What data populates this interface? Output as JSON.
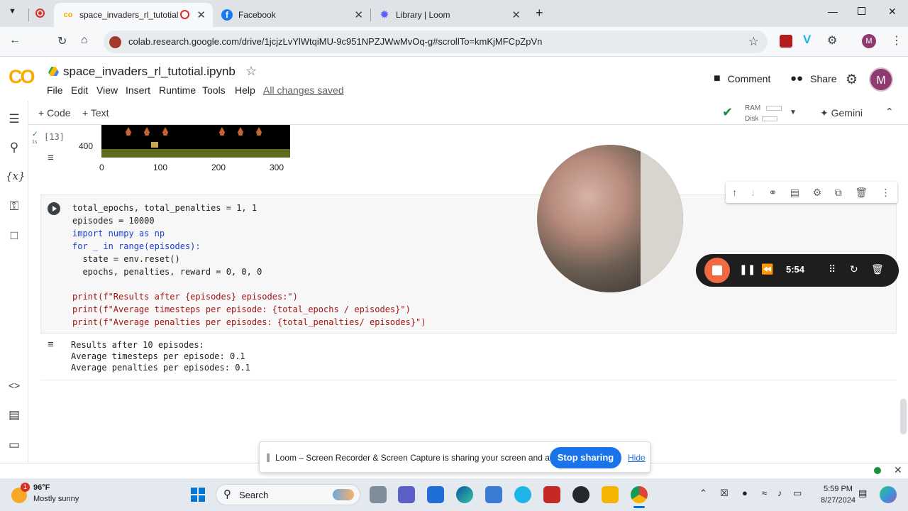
{
  "browser": {
    "tabs": [
      {
        "title": "space_invaders_rl_tutotial.ipynb",
        "active": true
      },
      {
        "title": "Facebook",
        "active": false
      },
      {
        "title": "Library | Loom",
        "active": false
      }
    ],
    "url": "colab.research.google.com/drive/1jcjzLvYlWtqiMU-9c951NPZJWwMvOq-g#scrollTo=kmKjMFCpZpVn",
    "profile_initial": "M"
  },
  "colab": {
    "logo": "CO",
    "notebook_title": "space_invaders_rl_tutotial.ipynb",
    "menu": [
      "File",
      "Edit",
      "View",
      "Insert",
      "Runtime",
      "Tools",
      "Help"
    ],
    "save_status": "All changes saved",
    "comment_label": "Comment",
    "share_label": "Share",
    "avatar_initial": "M",
    "toolbar": {
      "add_code": "+ Code",
      "add_text": "+ Text",
      "ram_label": "RAM",
      "disk_label": "Disk",
      "gemini_label": "Gemini"
    }
  },
  "prev_cell": {
    "exec_count": "[13]",
    "exec_time": "1s",
    "y_tick": "400",
    "x_ticks": [
      "0",
      "100",
      "200",
      "300"
    ]
  },
  "code_cell": {
    "lines": [
      "total_epochs, total_penalties = 1, 1",
      "episodes = 10000",
      "import numpy as np",
      "for _ in range(episodes):",
      "  state = env.reset()",
      "  epochs, penalties, reward = 0, 0, 0",
      "",
      "print(f\"Results after {episodes} episodes:\")",
      "print(f\"Average timesteps per episode: {total_epochs / episodes}\")",
      "print(f\"Average penalties per episodes: {total_penalties/ episodes}\")"
    ],
    "output": [
      "Results after 10 episodes:",
      "Average timesteps per episode: 0.1",
      "Average penalties per episodes: 0.1"
    ]
  },
  "loom": {
    "timer": "5:54",
    "banner_text": "Loom – Screen Recorder & Screen Capture is sharing your screen and audio.",
    "stop_label": "Stop sharing",
    "hide_label": "Hide"
  },
  "taskbar": {
    "weather_badge": "1",
    "temperature": "96°F",
    "condition": "Mostly sunny",
    "search_label": "Search",
    "time": "5:59 PM",
    "date": "8/27/2024"
  },
  "colors": {
    "accent_blue": "#1a73e8",
    "loom_orange": "#f16a44",
    "colab_orange": "#f9ab00"
  }
}
